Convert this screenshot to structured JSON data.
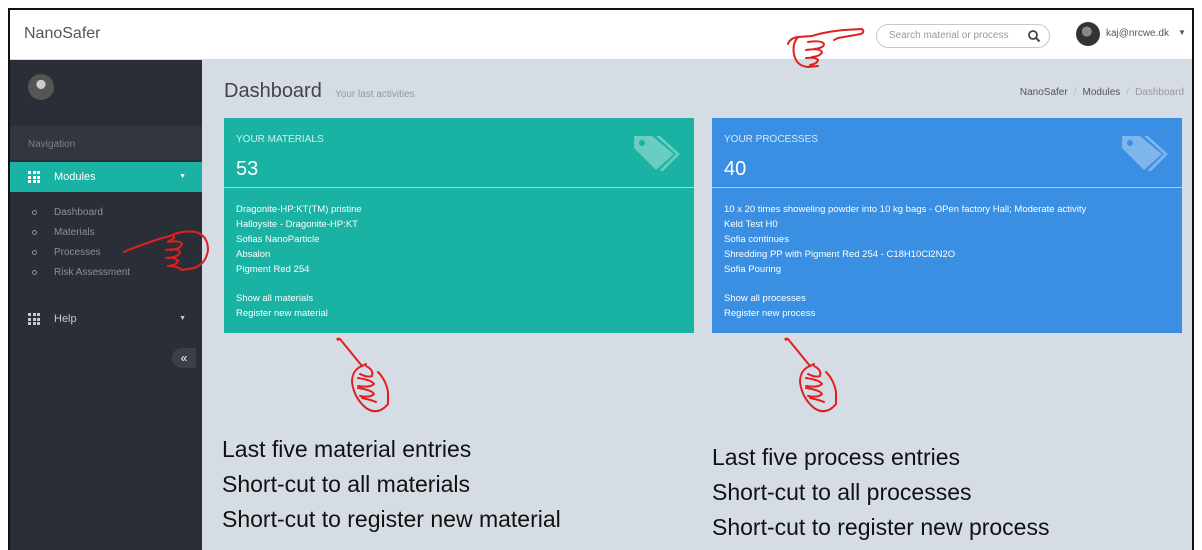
{
  "app": {
    "brand": "NanoSafer"
  },
  "search": {
    "placeholder": "Search material or process"
  },
  "user": {
    "email": "kaj@nrcwe.dk"
  },
  "sidebar": {
    "nav_header": "Navigation",
    "modules_label": "Modules",
    "sub_items": [
      "Dashboard",
      "Materials",
      "Processes",
      "Risk Assessment"
    ],
    "help_label": "Help",
    "collapse_glyph": "«"
  },
  "page": {
    "title": "Dashboard",
    "subtitle": "Your last activities"
  },
  "breadcrumb": [
    "NanoSafer",
    "Modules",
    "Dashboard"
  ],
  "materials_card": {
    "title": "YOUR MATERIALS",
    "count": "53",
    "items": [
      "Dragonite-HP:KT(TM) pristine",
      "Halloysite - Dragonite-HP:KT",
      "Sofias NanoParticle",
      "Absalon",
      "Pigment Red 254"
    ],
    "show_all": "Show all materials",
    "register": "Register new material",
    "color": "#1ab2a2"
  },
  "processes_card": {
    "title": "YOUR PROCESSES",
    "count": "40",
    "items": [
      "10 x 20 times showeling powder into 10 kg bags - OPen factory Hall; Moderate activity",
      "Keld Test H0",
      "Sofia continues",
      "Shredding PP with Pigment Red 254 - C18H10Cl2N2O",
      "Sofia Pouring"
    ],
    "show_all": "Show all processes",
    "register": "Register new process",
    "color": "#3a8fe2"
  },
  "annotations": {
    "left": [
      "Last five material entries",
      "Short-cut to all materials",
      "Short-cut to register new material"
    ],
    "right": [
      "Last five process entries",
      "Short-cut to all processes",
      "Short-cut to register new process"
    ]
  },
  "icons": {
    "search": "search-icon",
    "grid": "grid-icon",
    "tag": "tag-icon",
    "pointer": "pointing-hand-icon"
  }
}
